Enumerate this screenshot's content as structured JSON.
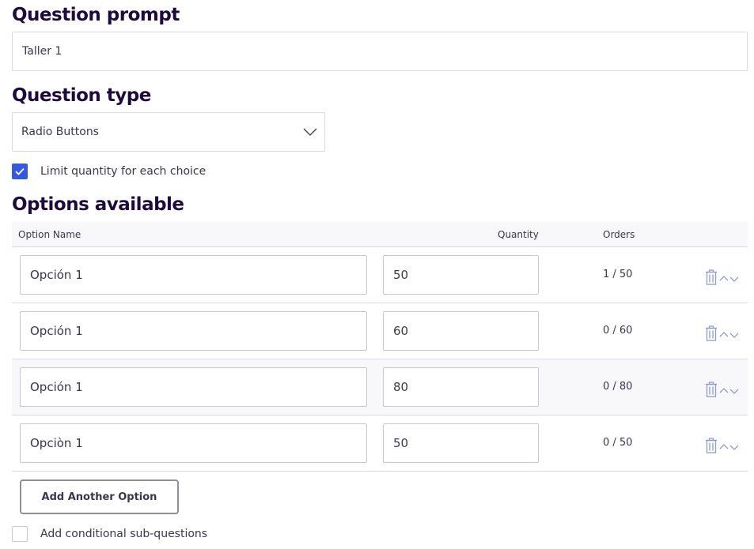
{
  "prompt": {
    "title": "Question prompt",
    "value": "Taller 1"
  },
  "question_type": {
    "title": "Question type",
    "selected": "Radio Buttons",
    "icon": "chevron-down-icon"
  },
  "limit_quantity": {
    "label": "Limit quantity for each choice",
    "checked": true
  },
  "options": {
    "title": "Options available",
    "headers": {
      "name": "Option Name",
      "quantity": "Quantity",
      "orders": "Orders"
    },
    "rows": [
      {
        "name": "Opción 1",
        "quantity": "50",
        "orders": "1 / 50"
      },
      {
        "name": "Opción 1",
        "quantity": "60",
        "orders": "0 / 60"
      },
      {
        "name": "Opción 1",
        "quantity": "80",
        "orders": "0 / 80"
      },
      {
        "name": "Opciòn 1",
        "quantity": "50",
        "orders": "0 / 50"
      }
    ],
    "row_icons": [
      "trash-icon",
      "reorder-chevrons-icon"
    ],
    "add_button": "Add Another Option"
  },
  "conditional": {
    "label": "Add conditional sub-questions",
    "checked": false
  },
  "colors": {
    "title": "#1e0a3c",
    "text": "#39364f",
    "accent": "#3659e3",
    "border": "#dbdae3",
    "header_bg": "#f8f7fa",
    "icon": "#8e9ccf"
  }
}
